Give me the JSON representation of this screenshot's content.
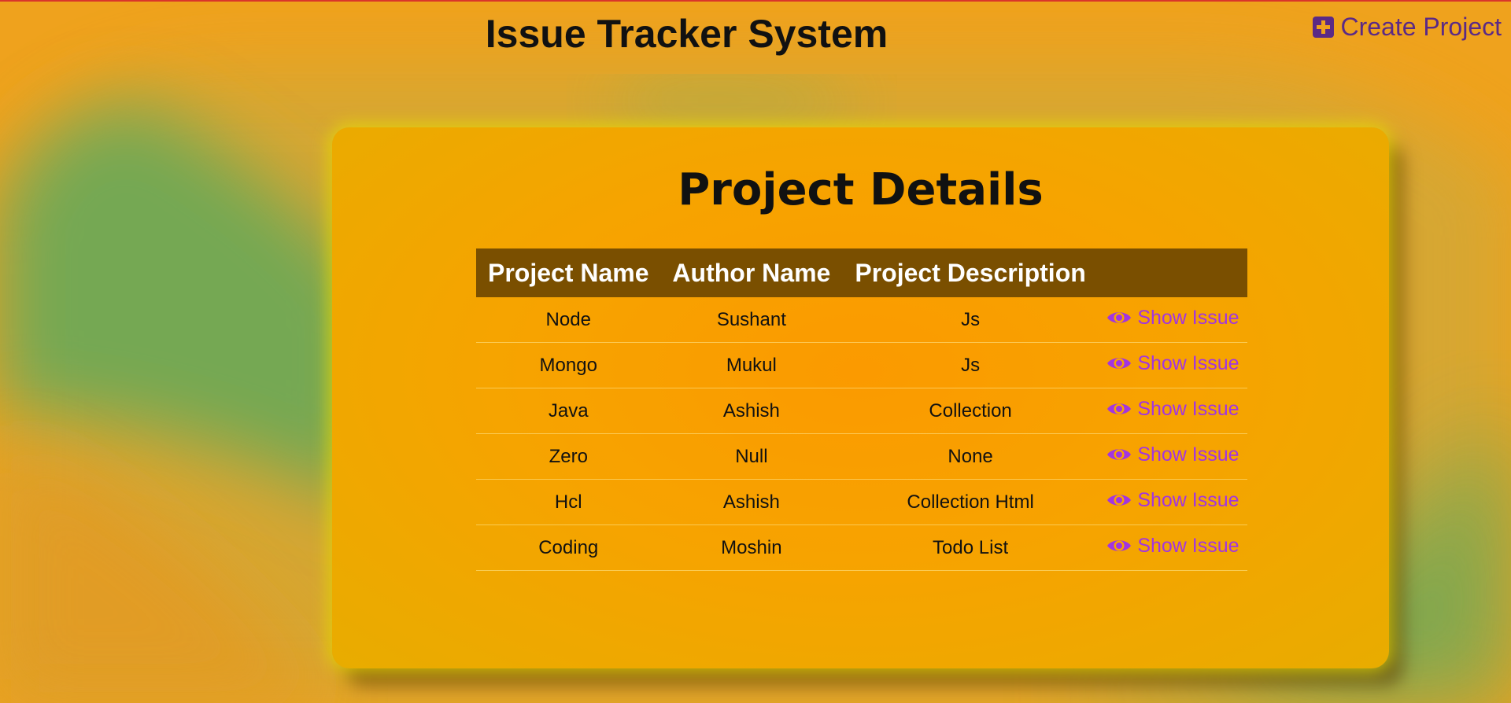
{
  "header": {
    "title": "Issue Tracker System",
    "create_project_label": "Create Project"
  },
  "card": {
    "title": "Project Details"
  },
  "table": {
    "columns": [
      "Project Name",
      "Author Name",
      "Project Description",
      ""
    ],
    "rows": [
      {
        "name": "Node",
        "author": "Sushant",
        "description": "Js",
        "action": "Show Issue"
      },
      {
        "name": "Mongo",
        "author": "Mukul",
        "description": "Js",
        "action": "Show Issue"
      },
      {
        "name": "Java",
        "author": "Ashish",
        "description": "Collection",
        "action": "Show Issue"
      },
      {
        "name": "Zero",
        "author": "Null",
        "description": "None",
        "action": "Show Issue"
      },
      {
        "name": "Hcl",
        "author": "Ashish",
        "description": "Collection Html",
        "action": "Show Issue"
      },
      {
        "name": "Coding",
        "author": "Moshin",
        "description": "Todo List",
        "action": "Show Issue"
      }
    ]
  },
  "icons": {
    "create": "plus-square-icon",
    "show": "eye-icon"
  },
  "colors": {
    "background_orange": "#efa21d",
    "background_green": "#75a853",
    "header_row": "#7a4f00",
    "link_purple": "#a235e0",
    "create_purple": "#5b2a86",
    "card_glow": "#e8de00"
  }
}
